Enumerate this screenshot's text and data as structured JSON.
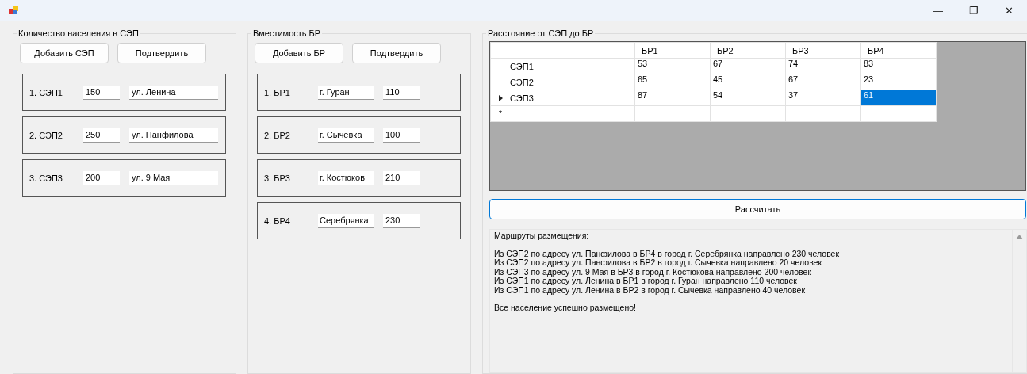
{
  "window": {
    "controls": [
      "—",
      "❐",
      "✕"
    ]
  },
  "population": {
    "title": "Количество населения в СЭП",
    "buttons": [
      "Добавить СЭП",
      "Подтвердить"
    ],
    "items": [
      {
        "label": "1. СЭП1",
        "count": "150",
        "address": "ул. Ленина"
      },
      {
        "label": "2. СЭП2",
        "count": "250",
        "address": "ул. Панфилова"
      },
      {
        "label": "3. СЭП3",
        "count": "200",
        "address": "ул. 9 Мая"
      }
    ]
  },
  "capacity": {
    "title": "Вместимость БР",
    "buttons": [
      "Добавить БР",
      "Подтвердить"
    ],
    "items": [
      {
        "label": "1. БР1",
        "city": "г. Гуран",
        "capacity": "110"
      },
      {
        "label": "2. БР2",
        "city": "г. Сычевка",
        "capacity": "100"
      },
      {
        "label": "3. БР3",
        "city": "г. Костюков",
        "capacity": "210"
      },
      {
        "label": "4. БР4",
        "city": "Серебрянка",
        "capacity": "230"
      }
    ]
  },
  "distance": {
    "title": "Расстояние от СЭП до БР",
    "table": {
      "columns": [
        "БР1",
        "БР2",
        "БР3",
        "БР4"
      ],
      "rows": [
        {
          "header": "СЭП1",
          "current": false,
          "cells": [
            {
              "value": "53",
              "selected": false
            },
            {
              "value": "67",
              "selected": false
            },
            {
              "value": "74",
              "selected": false
            },
            {
              "value": "83",
              "selected": false
            }
          ]
        },
        {
          "header": "СЭП2",
          "current": false,
          "cells": [
            {
              "value": "65",
              "selected": false
            },
            {
              "value": "45",
              "selected": false
            },
            {
              "value": "67",
              "selected": false
            },
            {
              "value": "23",
              "selected": false
            }
          ]
        },
        {
          "header": "СЭП3",
          "current": true,
          "cells": [
            {
              "value": "87",
              "selected": false
            },
            {
              "value": "54",
              "selected": false
            },
            {
              "value": "37",
              "selected": false
            },
            {
              "value": "61",
              "selected": true
            }
          ]
        }
      ],
      "new_row_mark": "*"
    },
    "button": "Рассчитать",
    "output": {
      "heading": "Маршруты размещения:",
      "routes": [
        "Из СЭП2 по адресу ул. Панфилова в БР4 в город г. Серебрянка направлено 230 человек",
        "Из СЭП2 по адресу ул. Панфилова в БР2 в город г. Сычевка направлено 20 человек",
        "Из СЭП3 по адресу ул. 9 Мая в БР3 в город г. Костюкова направлено 200 человек",
        "Из СЭП1 по адресу ул. Ленина в БР1 в город г. Гуран направлено 110 человек",
        "Из СЭП1 по адресу ул. Ленина в БР2 в город г. Сычевка направлено 40 человек"
      ],
      "summary": "Все население успешно размещено!"
    }
  }
}
